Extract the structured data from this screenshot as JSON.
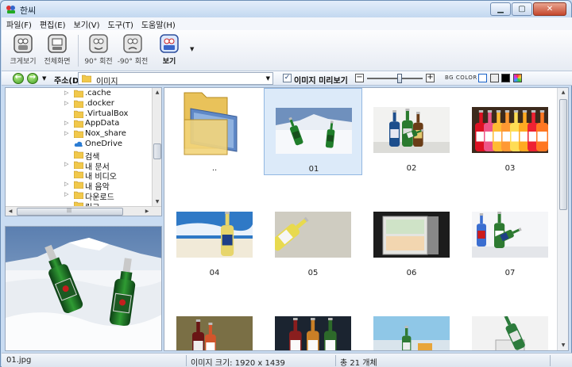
{
  "window": {
    "title": "한씨"
  },
  "menu": [
    {
      "label": "파일(F)"
    },
    {
      "label": "편집(E)"
    },
    {
      "label": "보기(V)"
    },
    {
      "label": "도구(T)"
    },
    {
      "label": "도움말(H)"
    }
  ],
  "toolbar": {
    "fit_label": "크게보기",
    "fullscreen_label": "전체화면",
    "rotate_cw_label": "90° 회전",
    "rotate_ccw_label": "-90° 회전",
    "view_label": "보기"
  },
  "address": {
    "label": "주소(D)",
    "path": "이미지",
    "preview_label": "이미지 미리보기",
    "preview_checked": "✓",
    "bg_color_label": "BG COLOR",
    "zoom_minus": "−",
    "zoom_plus": "+",
    "swatches": [
      "#ffffff",
      "#e8e8e8",
      "#000000",
      "multi"
    ]
  },
  "tree": {
    "items": [
      {
        "label": ".cache",
        "expandable": true,
        "icon": "folder-icon"
      },
      {
        "label": ".docker",
        "expandable": true,
        "icon": "folder-icon"
      },
      {
        "label": ".VirtualBox",
        "expandable": false,
        "icon": "folder-icon"
      },
      {
        "label": "AppData",
        "expandable": true,
        "icon": "folder-icon"
      },
      {
        "label": "Nox_share",
        "expandable": true,
        "icon": "folder-icon"
      },
      {
        "label": "OneDrive",
        "expandable": false,
        "icon": "cloud-icon"
      },
      {
        "label": "검색",
        "expandable": false,
        "icon": "folder-icon"
      },
      {
        "label": "내 문서",
        "expandable": true,
        "icon": "folder-icon"
      },
      {
        "label": "내 비디오",
        "expandable": false,
        "icon": "folder-icon"
      },
      {
        "label": "내 음악",
        "expandable": true,
        "icon": "folder-icon"
      },
      {
        "label": "다운로드",
        "expandable": true,
        "icon": "folder-icon"
      },
      {
        "label": "링크",
        "expandable": false,
        "icon": "folder-icon"
      }
    ]
  },
  "thumbnails": [
    {
      "label": "..",
      "kind": "folder"
    },
    {
      "label": "01",
      "kind": "snow",
      "selected": true
    },
    {
      "label": "02",
      "kind": "bottles-table"
    },
    {
      "label": "03",
      "kind": "shelf"
    },
    {
      "label": "04",
      "kind": "beach"
    },
    {
      "label": "05",
      "kind": "lying-bottle"
    },
    {
      "label": "06",
      "kind": "fridge"
    },
    {
      "label": "07",
      "kind": "peroni"
    },
    {
      "label": "",
      "kind": "wine-table"
    },
    {
      "label": "",
      "kind": "three-bottles"
    },
    {
      "label": "",
      "kind": "cafe"
    },
    {
      "label": "",
      "kind": "bucket"
    }
  ],
  "status": {
    "filename": "01.jpg",
    "size": "이미지 크기: 1920 x 1439",
    "count": "총 21 개체"
  },
  "colors": {
    "selection_bg": "#dceaf9",
    "selection_border": "#92b7e2",
    "window_frame": "#c9dcf2"
  }
}
